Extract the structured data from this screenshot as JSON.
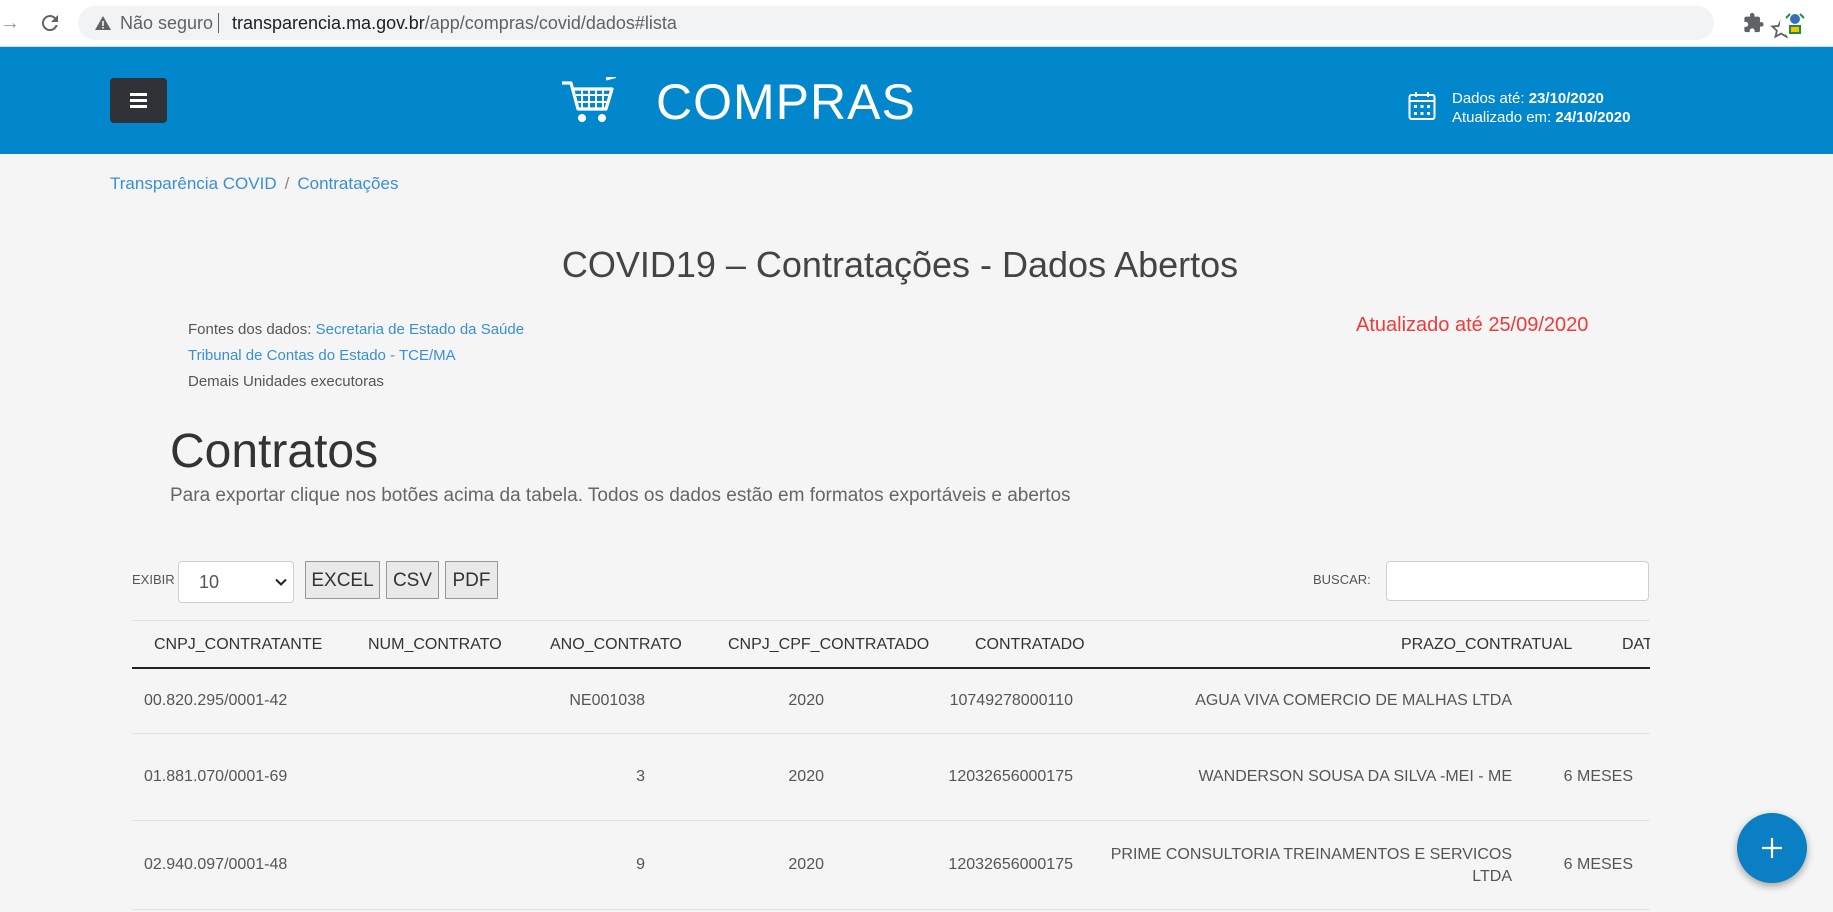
{
  "browser": {
    "security_label": "Não seguro",
    "url_host": "transparencia.ma.gov.br",
    "url_path": "/app/compras/covid/dados#lista"
  },
  "header": {
    "title": "COMPRAS",
    "data_until_label": "Dados até:",
    "data_until_value": "23/10/2020",
    "updated_on_label": "Atualizado em:",
    "updated_on_value": "24/10/2020",
    "color": "#0387cc"
  },
  "breadcrumb": {
    "items": [
      "Transparência COVID",
      "Contratações"
    ],
    "separator": "/"
  },
  "page": {
    "title": "COVID19 – Contratações - Dados Abertos",
    "sources_label": "Fontes dos dados:",
    "source_1": "Secretaria de Estado da Saúde",
    "source_2": "Tribunal de Contas do Estado - TCE/MA",
    "source_3": "Demais Unidades executoras",
    "updated_until": "Atualizado até 25/09/2020"
  },
  "section": {
    "title": "Contratos",
    "subtitle": "Para exportar clique nos botões acima da tabela. Todos os dados estão em formatos exportáveis e abertos"
  },
  "toolbar": {
    "show_label": "EXIBIR",
    "page_size": "10",
    "excel_label": "EXCEL",
    "csv_label": "CSV",
    "pdf_label": "PDF",
    "search_label": "BUSCAR:",
    "search_value": ""
  },
  "table": {
    "columns": [
      "CNPJ_CONTRATANTE",
      "NUM_CONTRATO",
      "ANO_CONTRATO",
      "CNPJ_CPF_CONTRATADO",
      "CONTRATADO",
      "PRAZO_CONTRATUAL",
      "DAT"
    ],
    "rows": [
      [
        "00.820.295/0001-42",
        "NE001038",
        "2020",
        "10749278000110",
        "AGUA VIVA COMERCIO DE MALHAS LTDA",
        ""
      ],
      [
        "01.881.070/0001-69",
        "3",
        "2020",
        "12032656000175",
        "WANDERSON SOUSA DA SILVA -MEI - ME",
        "6 MESES"
      ],
      [
        "02.940.097/0001-48",
        "9",
        "2020",
        "12032656000175",
        "PRIME CONSULTORIA TREINAMENTOS E SERVICOS LTDA",
        "6 MESES"
      ]
    ]
  },
  "fab": {
    "icon": "plus-icon",
    "color": "#0a7fc3"
  },
  "colors": {
    "link": "#3a8fd3",
    "alert": "#f03a3a"
  }
}
